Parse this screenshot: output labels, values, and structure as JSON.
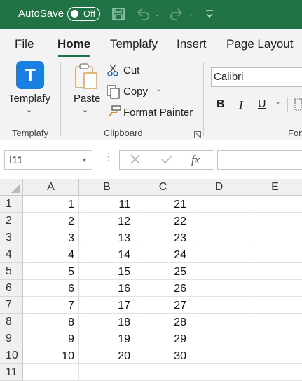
{
  "titlebar": {
    "autosave_label": "AutoSave",
    "autosave_state": "Off",
    "icons": [
      "save-icon",
      "undo-icon",
      "redo-icon",
      "customize-qat-icon"
    ]
  },
  "tabs": [
    {
      "label": "File"
    },
    {
      "label": "Home"
    },
    {
      "label": "Templafy"
    },
    {
      "label": "Insert"
    },
    {
      "label": "Page Layout"
    }
  ],
  "ribbon": {
    "templafy": {
      "button_label": "Templafy",
      "group_label": "Templafy",
      "logo_letter": "T"
    },
    "clipboard": {
      "paste_label": "Paste",
      "cut_label": "Cut",
      "copy_label": "Copy",
      "format_painter_label": "Format Painter",
      "group_label": "Clipboard"
    },
    "font": {
      "font_name": "Calibri",
      "bold": "B",
      "italic": "I",
      "underline": "U",
      "group_label_partial": "Fon"
    }
  },
  "formula_bar": {
    "name_box": "I11",
    "function_label": "fx"
  },
  "grid": {
    "columns": [
      "A",
      "B",
      "C",
      "D",
      "E"
    ],
    "rows": [
      {
        "n": "1",
        "cells": [
          "1",
          "11",
          "21",
          "",
          ""
        ]
      },
      {
        "n": "2",
        "cells": [
          "2",
          "12",
          "22",
          "",
          ""
        ]
      },
      {
        "n": "3",
        "cells": [
          "3",
          "13",
          "23",
          "",
          ""
        ]
      },
      {
        "n": "4",
        "cells": [
          "4",
          "14",
          "24",
          "",
          ""
        ]
      },
      {
        "n": "5",
        "cells": [
          "5",
          "15",
          "25",
          "",
          ""
        ]
      },
      {
        "n": "6",
        "cells": [
          "6",
          "16",
          "26",
          "",
          ""
        ]
      },
      {
        "n": "7",
        "cells": [
          "7",
          "17",
          "27",
          "",
          ""
        ]
      },
      {
        "n": "8",
        "cells": [
          "8",
          "18",
          "28",
          "",
          ""
        ]
      },
      {
        "n": "9",
        "cells": [
          "9",
          "19",
          "29",
          "",
          ""
        ]
      },
      {
        "n": "10",
        "cells": [
          "10",
          "20",
          "30",
          "",
          ""
        ]
      },
      {
        "n": "11",
        "cells": [
          "",
          "",
          "",
          "",
          ""
        ]
      }
    ]
  },
  "colors": {
    "excel_green": "#217346",
    "templafy_blue": "#1a7fe0"
  }
}
